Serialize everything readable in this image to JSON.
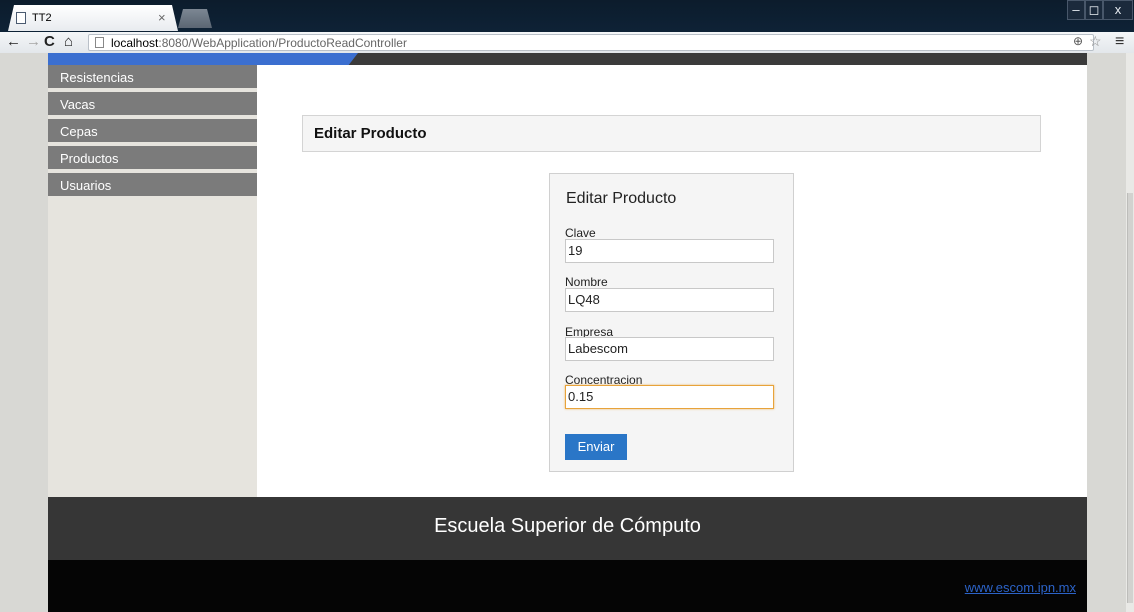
{
  "browser": {
    "tab_title": "TT2",
    "tab_close": "×",
    "url_host": "localhost",
    "url_rest": ":8080/WebApplication/ProductoReadController",
    "window_controls": {
      "minimize": "–",
      "maximize": "◻",
      "close": "x"
    },
    "icons": [
      "back-icon",
      "forward-icon",
      "reload-icon",
      "home-icon",
      "zoom-icon",
      "star-icon",
      "menu-icon"
    ]
  },
  "sidebar": {
    "items": [
      {
        "label": "Resistencias"
      },
      {
        "label": "Vacas"
      },
      {
        "label": "Cepas"
      },
      {
        "label": "Productos"
      },
      {
        "label": "Usuarios"
      }
    ]
  },
  "main": {
    "heading": "Editar Producto",
    "form": {
      "title": "Editar Producto",
      "fields": [
        {
          "label": "Clave",
          "value": "19"
        },
        {
          "label": "Nombre",
          "value": "LQ48"
        },
        {
          "label": "Empresa",
          "value": "Labescom"
        },
        {
          "label": "Concentracion",
          "value": "0.15"
        }
      ],
      "submit_label": "Enviar"
    }
  },
  "footer": {
    "title": "Escuela Superior de Cómputo",
    "link": "www.escom.ipn.mx"
  },
  "colors": {
    "accent": "#2a76c7",
    "focus_border": "#e8a33a",
    "sidebar_item": "#7b7b7b"
  }
}
